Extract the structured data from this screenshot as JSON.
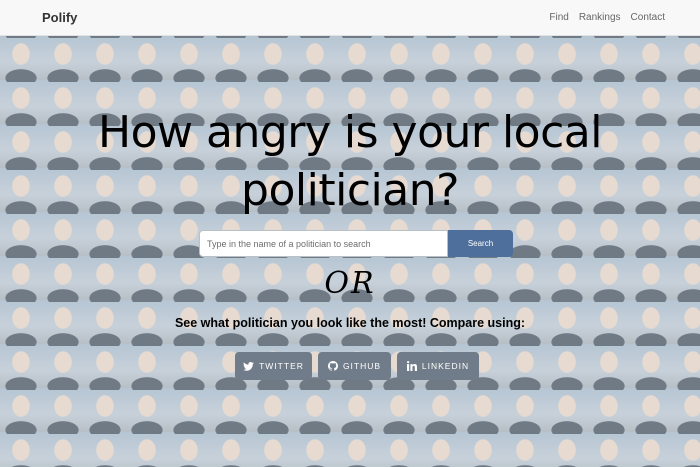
{
  "navbar": {
    "brand": "Polify",
    "links": [
      "Find",
      "Rankings",
      "Contact"
    ]
  },
  "hero": {
    "headline_line1": "How angry is your local",
    "headline_line2": "politician?",
    "search": {
      "placeholder": "Type in the name of a politician to search",
      "button_label": "Search"
    },
    "or_text": "OR",
    "compare_text": "See what politician you look like the most! Compare using:",
    "social_buttons": [
      {
        "label": "TWITTER",
        "icon": "twitter-icon"
      },
      {
        "label": "GITHUB",
        "icon": "github-icon"
      },
      {
        "label": "LINKEDIN",
        "icon": "linkedin-icon"
      }
    ]
  },
  "colors": {
    "search_button": "#4e6f9b",
    "social_button": "#707c89",
    "navbar_bg": "#f8f8f8"
  }
}
